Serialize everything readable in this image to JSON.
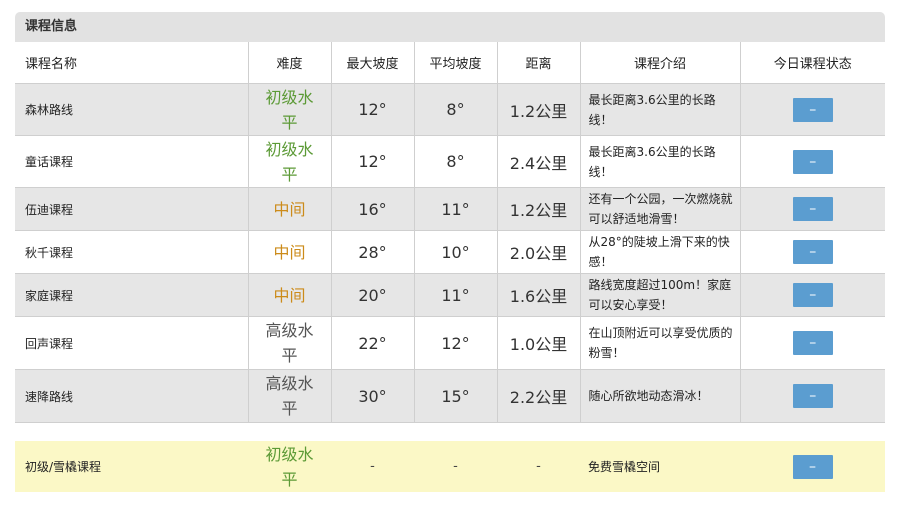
{
  "section_title": "课程信息",
  "headers": {
    "name": "课程名称",
    "difficulty": "难度",
    "max_slope": "最大坡度",
    "avg_slope": "平均坡度",
    "distance": "距离",
    "intro": "课程介绍",
    "status": "今日课程状态"
  },
  "courses": [
    {
      "name": "森林路线",
      "level": "初级水平",
      "level_color": "#5c9a36",
      "max_slope": "12°",
      "avg_slope": "8°",
      "distance": "1.2公里",
      "intro": "最长距离3.6公里的长路线！",
      "status": "–"
    },
    {
      "name": "童话课程",
      "level": "初级水平",
      "level_color": "#5c9a36",
      "max_slope": "12°",
      "avg_slope": "8°",
      "distance": "2.4公里",
      "intro": "最长距离3.6公里的长路线！",
      "status": "–"
    },
    {
      "name": "伍迪课程",
      "level": "中间",
      "level_color": "#cc8b1a",
      "max_slope": "16°",
      "avg_slope": "11°",
      "distance": "1.2公里",
      "intro": "还有一个公园，一次燃烧就可以舒适地滑雪！",
      "status": "–"
    },
    {
      "name": "秋千课程",
      "level": "中间",
      "level_color": "#cc8b1a",
      "max_slope": "28°",
      "avg_slope": "10°",
      "distance": "2.0公里",
      "intro": "从28°的陡坡上滑下来的快感！",
      "status": "–"
    },
    {
      "name": "家庭课程",
      "level": "中间",
      "level_color": "#cc8b1a",
      "max_slope": "20°",
      "avg_slope": "11°",
      "distance": "1.6公里",
      "intro": "路线宽度超过100m！家庭可以安心享受！",
      "status": "–"
    },
    {
      "name": "回声课程",
      "level": "高级水平",
      "level_color": "#555555",
      "max_slope": "22°",
      "avg_slope": "12°",
      "distance": "1.0公里",
      "intro": "在山顶附近可以享受优质的粉雪！",
      "status": "–"
    },
    {
      "name": "速降路线",
      "level": "高级水平",
      "level_color": "#555555",
      "max_slope": "30°",
      "avg_slope": "15°",
      "distance": "2.2公里",
      "intro": "随心所欲地动态滑冰！",
      "status": "–"
    }
  ],
  "sled_course": {
    "name": "初级/雪橇课程",
    "level": "初级水平",
    "level_color": "#5c9a36",
    "max_slope": "-",
    "avg_slope": "-",
    "distance": "-",
    "intro": "免费雪橇空间",
    "status": "–"
  }
}
